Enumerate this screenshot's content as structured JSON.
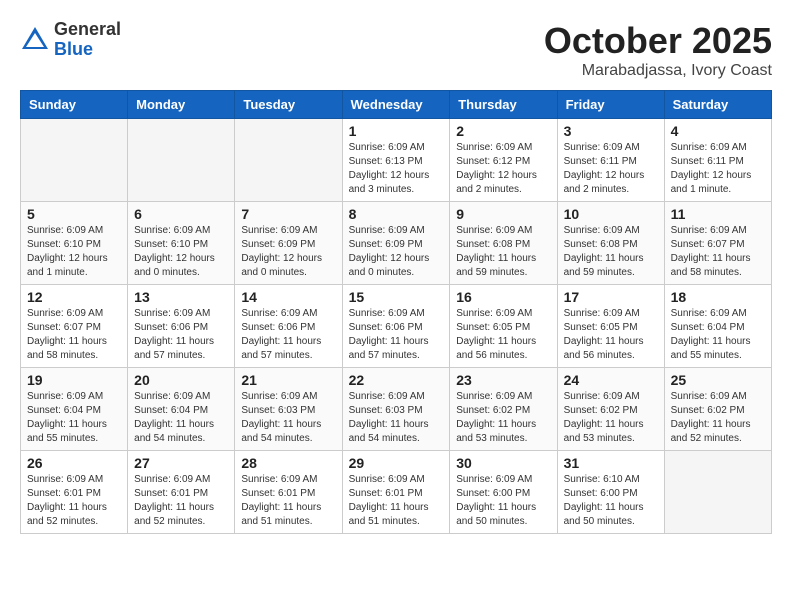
{
  "logo": {
    "general": "General",
    "blue": "Blue"
  },
  "header": {
    "month": "October 2025",
    "location": "Marabadjassa, Ivory Coast"
  },
  "weekdays": [
    "Sunday",
    "Monday",
    "Tuesday",
    "Wednesday",
    "Thursday",
    "Friday",
    "Saturday"
  ],
  "weeks": [
    [
      {
        "day": "",
        "info": ""
      },
      {
        "day": "",
        "info": ""
      },
      {
        "day": "",
        "info": ""
      },
      {
        "day": "1",
        "info": "Sunrise: 6:09 AM\nSunset: 6:13 PM\nDaylight: 12 hours and 3 minutes."
      },
      {
        "day": "2",
        "info": "Sunrise: 6:09 AM\nSunset: 6:12 PM\nDaylight: 12 hours and 2 minutes."
      },
      {
        "day": "3",
        "info": "Sunrise: 6:09 AM\nSunset: 6:11 PM\nDaylight: 12 hours and 2 minutes."
      },
      {
        "day": "4",
        "info": "Sunrise: 6:09 AM\nSunset: 6:11 PM\nDaylight: 12 hours and 1 minute."
      }
    ],
    [
      {
        "day": "5",
        "info": "Sunrise: 6:09 AM\nSunset: 6:10 PM\nDaylight: 12 hours and 1 minute."
      },
      {
        "day": "6",
        "info": "Sunrise: 6:09 AM\nSunset: 6:10 PM\nDaylight: 12 hours and 0 minutes."
      },
      {
        "day": "7",
        "info": "Sunrise: 6:09 AM\nSunset: 6:09 PM\nDaylight: 12 hours and 0 minutes."
      },
      {
        "day": "8",
        "info": "Sunrise: 6:09 AM\nSunset: 6:09 PM\nDaylight: 12 hours and 0 minutes."
      },
      {
        "day": "9",
        "info": "Sunrise: 6:09 AM\nSunset: 6:08 PM\nDaylight: 11 hours and 59 minutes."
      },
      {
        "day": "10",
        "info": "Sunrise: 6:09 AM\nSunset: 6:08 PM\nDaylight: 11 hours and 59 minutes."
      },
      {
        "day": "11",
        "info": "Sunrise: 6:09 AM\nSunset: 6:07 PM\nDaylight: 11 hours and 58 minutes."
      }
    ],
    [
      {
        "day": "12",
        "info": "Sunrise: 6:09 AM\nSunset: 6:07 PM\nDaylight: 11 hours and 58 minutes."
      },
      {
        "day": "13",
        "info": "Sunrise: 6:09 AM\nSunset: 6:06 PM\nDaylight: 11 hours and 57 minutes."
      },
      {
        "day": "14",
        "info": "Sunrise: 6:09 AM\nSunset: 6:06 PM\nDaylight: 11 hours and 57 minutes."
      },
      {
        "day": "15",
        "info": "Sunrise: 6:09 AM\nSunset: 6:06 PM\nDaylight: 11 hours and 57 minutes."
      },
      {
        "day": "16",
        "info": "Sunrise: 6:09 AM\nSunset: 6:05 PM\nDaylight: 11 hours and 56 minutes."
      },
      {
        "day": "17",
        "info": "Sunrise: 6:09 AM\nSunset: 6:05 PM\nDaylight: 11 hours and 56 minutes."
      },
      {
        "day": "18",
        "info": "Sunrise: 6:09 AM\nSunset: 6:04 PM\nDaylight: 11 hours and 55 minutes."
      }
    ],
    [
      {
        "day": "19",
        "info": "Sunrise: 6:09 AM\nSunset: 6:04 PM\nDaylight: 11 hours and 55 minutes."
      },
      {
        "day": "20",
        "info": "Sunrise: 6:09 AM\nSunset: 6:04 PM\nDaylight: 11 hours and 54 minutes."
      },
      {
        "day": "21",
        "info": "Sunrise: 6:09 AM\nSunset: 6:03 PM\nDaylight: 11 hours and 54 minutes."
      },
      {
        "day": "22",
        "info": "Sunrise: 6:09 AM\nSunset: 6:03 PM\nDaylight: 11 hours and 54 minutes."
      },
      {
        "day": "23",
        "info": "Sunrise: 6:09 AM\nSunset: 6:02 PM\nDaylight: 11 hours and 53 minutes."
      },
      {
        "day": "24",
        "info": "Sunrise: 6:09 AM\nSunset: 6:02 PM\nDaylight: 11 hours and 53 minutes."
      },
      {
        "day": "25",
        "info": "Sunrise: 6:09 AM\nSunset: 6:02 PM\nDaylight: 11 hours and 52 minutes."
      }
    ],
    [
      {
        "day": "26",
        "info": "Sunrise: 6:09 AM\nSunset: 6:01 PM\nDaylight: 11 hours and 52 minutes."
      },
      {
        "day": "27",
        "info": "Sunrise: 6:09 AM\nSunset: 6:01 PM\nDaylight: 11 hours and 52 minutes."
      },
      {
        "day": "28",
        "info": "Sunrise: 6:09 AM\nSunset: 6:01 PM\nDaylight: 11 hours and 51 minutes."
      },
      {
        "day": "29",
        "info": "Sunrise: 6:09 AM\nSunset: 6:01 PM\nDaylight: 11 hours and 51 minutes."
      },
      {
        "day": "30",
        "info": "Sunrise: 6:09 AM\nSunset: 6:00 PM\nDaylight: 11 hours and 50 minutes."
      },
      {
        "day": "31",
        "info": "Sunrise: 6:10 AM\nSunset: 6:00 PM\nDaylight: 11 hours and 50 minutes."
      },
      {
        "day": "",
        "info": ""
      }
    ]
  ]
}
